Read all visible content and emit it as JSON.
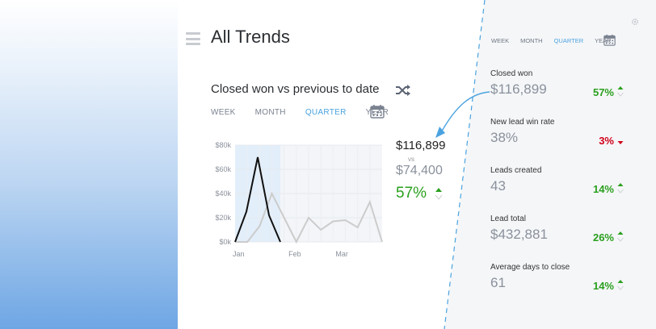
{
  "page": {
    "title": "All Trends"
  },
  "card": {
    "title": "Closed won vs previous to date",
    "tabs": [
      {
        "label": "WEEK",
        "active": false
      },
      {
        "label": "MONTH",
        "active": false
      },
      {
        "label": "QUARTER",
        "active": true
      },
      {
        "label": "YEAR",
        "active": false
      }
    ],
    "comparison": {
      "current": "$116,899",
      "vs_label": "vs",
      "previous": "$74,400",
      "percent": "57%",
      "direction": "up"
    }
  },
  "chart_data": {
    "type": "line",
    "x_tick_labels": [
      "Jan",
      "Feb",
      "Mar"
    ],
    "y_tick_labels": [
      "$80k",
      "$60k",
      "$40k",
      "$20k",
      "$0k"
    ],
    "ylim": [
      0,
      80000
    ],
    "series": [
      {
        "values": [
          0,
          25000,
          70000,
          22000,
          0
        ],
        "color": "#111111"
      },
      {
        "values": [
          0,
          0,
          13000,
          40000,
          20000,
          0,
          20000,
          10000,
          17000,
          18000,
          12000,
          33000,
          0
        ],
        "color": "#cccccc"
      }
    ],
    "highlight_band": "first-period"
  },
  "sidebar": {
    "tabs": [
      {
        "label": "WEEK",
        "active": false
      },
      {
        "label": "MONTH",
        "active": false
      },
      {
        "label": "QUARTER",
        "active": true
      },
      {
        "label": "YEAR",
        "active": false
      }
    ],
    "metrics": [
      {
        "label": "Closed won",
        "value": "$116,899",
        "percent": "57%",
        "direction": "up"
      },
      {
        "label": "New lead win rate",
        "value": "38%",
        "percent": "3%",
        "direction": "down"
      },
      {
        "label": "Leads created",
        "value": "43",
        "percent": "14%",
        "direction": "up"
      },
      {
        "label": "Lead total",
        "value": "$432,881",
        "percent": "26%",
        "direction": "up"
      },
      {
        "label": "Average days to close",
        "value": "61",
        "percent": "14%",
        "direction": "up"
      }
    ]
  },
  "colors": {
    "accent": "#4aa3df",
    "up": "#2aa01e",
    "down": "#d0021b",
    "muted": "#8a919c"
  },
  "icons": {
    "menu": "hamburger-icon",
    "shuffle": "shuffle-icon",
    "calendar": "calendar-icon",
    "settings": "gear-icon"
  }
}
